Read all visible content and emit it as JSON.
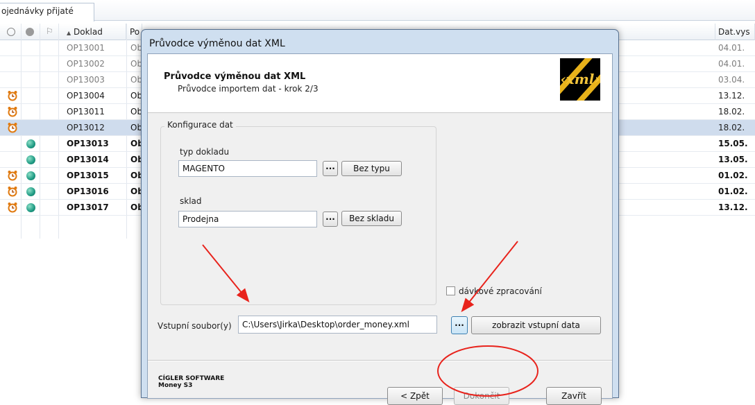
{
  "tabs": [
    {
      "label": "ojednávky přijaté"
    }
  ],
  "columns": {
    "doc": "Doklad",
    "po": "Po",
    "date": "Dat.vys"
  },
  "rows": [
    {
      "doc": "OP13001",
      "po": "Ob",
      "date": "04.01.",
      "style": "faded",
      "alarm": false,
      "globe": false
    },
    {
      "doc": "OP13002",
      "po": "Ob",
      "date": "04.01.",
      "style": "faded",
      "alarm": false,
      "globe": false
    },
    {
      "doc": "OP13003",
      "po": "Ob",
      "date": "03.04.",
      "style": "faded",
      "alarm": false,
      "globe": false
    },
    {
      "doc": "OP13004",
      "po": "Ob",
      "date": "13.12.",
      "style": "normal",
      "alarm": true,
      "globe": false
    },
    {
      "doc": "OP13011",
      "po": "Ob",
      "date": "18.02.",
      "style": "normal",
      "alarm": true,
      "globe": false
    },
    {
      "doc": "OP13012",
      "po": "Ob",
      "date": "18.02.",
      "style": "normal",
      "alarm": true,
      "globe": false,
      "selected": true
    },
    {
      "doc": "OP13013",
      "po": "Ob",
      "date": "15.05.",
      "style": "bold",
      "alarm": false,
      "globe": true
    },
    {
      "doc": "OP13014",
      "po": "Ob",
      "date": "13.05.",
      "style": "bold",
      "alarm": false,
      "globe": true
    },
    {
      "doc": "OP13015",
      "po": "Ob",
      "date": "01.02.",
      "style": "bold",
      "alarm": true,
      "globe": true
    },
    {
      "doc": "OP13016",
      "po": "Ob",
      "date": "01.02.",
      "style": "bold",
      "alarm": true,
      "globe": true
    },
    {
      "doc": "OP13017",
      "po": "Ob",
      "date": "13.12.",
      "style": "bold",
      "alarm": true,
      "globe": true
    }
  ],
  "dialog": {
    "window_title": "Průvodce výměnou dat XML",
    "banner_title": "Průvodce výměnou dat XML",
    "banner_subtitle": "Průvodce importem dat - krok 2/3",
    "logo_text": "‹xml›",
    "group_title": "Konfigurace dat",
    "doc_type_label": "typ dokladu",
    "doc_type_value": "MAGENTO",
    "doc_type_none": "Bez typu",
    "warehouse_label": "sklad",
    "warehouse_value": "Prodejna",
    "warehouse_none": "Bez skladu",
    "browse": "...",
    "batch_label": "dávkové zpracování",
    "batch_checked": false,
    "input_label": "Vstupní soubor(y)",
    "input_value": "C:\\Users\\Jirka\\Desktop\\order_money.xml",
    "show_input": "zobrazit vstupní data",
    "company_line1": "CÍGLER SOFTWARE",
    "company_line2": "Money S3",
    "back": "< Zpět",
    "finish": "Dokončit",
    "close": "Zavřít"
  },
  "colors": {
    "annotation": "#e8231c",
    "selection": "#cfdced",
    "globe": "#1e9a83",
    "alarm": "#e07a10"
  }
}
